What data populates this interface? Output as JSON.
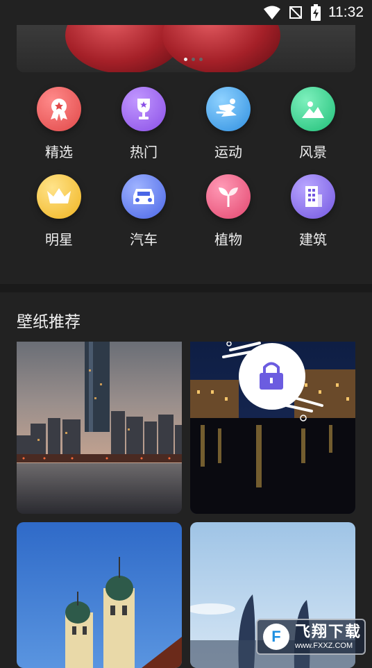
{
  "status_bar": {
    "time": "11:32"
  },
  "categories": [
    {
      "label": "精选",
      "icon": "award-ribbon-icon",
      "color": "#ee5a5a"
    },
    {
      "label": "热门",
      "icon": "trophy-icon",
      "color": "#9a62ee"
    },
    {
      "label": "运动",
      "icon": "sport-runner-icon",
      "color": "#3fa6ee"
    },
    {
      "label": "风景",
      "icon": "mountain-landscape-icon",
      "color": "#2fcf8c"
    },
    {
      "label": "明星",
      "icon": "crown-icon",
      "color": "#f5c437"
    },
    {
      "label": "汽车",
      "icon": "car-icon",
      "color": "#5e7bee"
    },
    {
      "label": "植物",
      "icon": "plant-sprout-icon",
      "color": "#ee5a7e"
    },
    {
      "label": "建筑",
      "icon": "building-icon",
      "color": "#8c72ee"
    }
  ],
  "banner": {
    "pages": 3,
    "active_page": 1
  },
  "section": {
    "title": "壁纸推荐"
  },
  "watermark": {
    "title": "飞翔下载",
    "url": "www.FXXZ.COM"
  }
}
